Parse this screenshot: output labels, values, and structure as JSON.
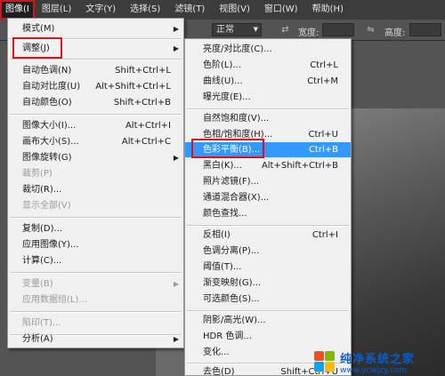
{
  "menubar": {
    "items": [
      "图像(I)",
      "图层(L)",
      "文字(Y)",
      "选择(S)",
      "滤镜(T)",
      "视图(V)",
      "窗口(W)",
      "帮助(H)"
    ],
    "active_display": "图像(I"
  },
  "optionsbar": {
    "mode_value": "正常",
    "width_label": "宽度:",
    "height_label": "高度:"
  },
  "image_menu": {
    "mode": {
      "label": "模式(M)"
    },
    "adjust": {
      "label": "调整(J)"
    },
    "auto_tone": {
      "label": "自动色调(N)",
      "shortcut": "Shift+Ctrl+L"
    },
    "auto_contrast": {
      "label": "自动对比度(U)",
      "shortcut": "Alt+Shift+Ctrl+L"
    },
    "auto_color": {
      "label": "自动颜色(O)",
      "shortcut": "Shift+Ctrl+B"
    },
    "image_size": {
      "label": "图像大小(I)...",
      "shortcut": "Alt+Ctrl+I"
    },
    "canvas_size": {
      "label": "画布大小(S)...",
      "shortcut": "Alt+Ctrl+C"
    },
    "image_rotation": {
      "label": "图像旋转(G)"
    },
    "crop": {
      "label": "裁剪(P)"
    },
    "trim": {
      "label": "裁切(R)..."
    },
    "reveal_all": {
      "label": "显示全部(V)"
    },
    "duplicate": {
      "label": "复制(D)..."
    },
    "apply_image": {
      "label": "应用图像(Y)..."
    },
    "calculations": {
      "label": "计算(C)..."
    },
    "variables": {
      "label": "变量(B)"
    },
    "apply_data_set": {
      "label": "应用数据组(L)..."
    },
    "trap": {
      "label": "陷印(T)..."
    },
    "analysis": {
      "label": "分析(A)"
    }
  },
  "adjust_menu": {
    "brightness_contrast": {
      "label": "亮度/对比度(C)..."
    },
    "levels": {
      "label": "色阶(L)...",
      "shortcut": "Ctrl+L"
    },
    "curves": {
      "label": "曲线(U)...",
      "shortcut": "Ctrl+M"
    },
    "exposure": {
      "label": "曝光度(E)..."
    },
    "vibrance": {
      "label": "自然饱和度(V)..."
    },
    "hue_saturation": {
      "label": "色相/饱和度(H)...",
      "shortcut": "Ctrl+U"
    },
    "color_balance": {
      "label": "色彩平衡(B)...",
      "shortcut": "Ctrl+B"
    },
    "black_white": {
      "label": "黑白(K)...",
      "shortcut": "Alt+Shift+Ctrl+B"
    },
    "photo_filter": {
      "label": "照片滤镜(F)..."
    },
    "channel_mixer": {
      "label": "通道混合器(X)..."
    },
    "color_lookup": {
      "label": "颜色查找..."
    },
    "invert": {
      "label": "反相(I)",
      "shortcut": "Ctrl+I"
    },
    "posterize": {
      "label": "色调分离(P)..."
    },
    "threshold": {
      "label": "阈值(T)..."
    },
    "gradient_map": {
      "label": "渐变映射(G)..."
    },
    "selective_color": {
      "label": "可选颜色(S)..."
    },
    "shadows_highlights": {
      "label": "阴影/高光(W)..."
    },
    "hdr_toning": {
      "label": "HDR 色调..."
    },
    "variations": {
      "label": "变化..."
    },
    "desaturate": {
      "label": "去色(D)",
      "shortcut": "Shift+Ctrl+U"
    }
  },
  "watermark": {
    "title": "纯净系统之家",
    "url": "www.ycwjzy.com"
  },
  "colors": {
    "highlight": "#3399ff",
    "callout_red": "#e0101a",
    "menubar_bg": "#3c3c3c",
    "menu_bg": "#f0f0f0"
  }
}
